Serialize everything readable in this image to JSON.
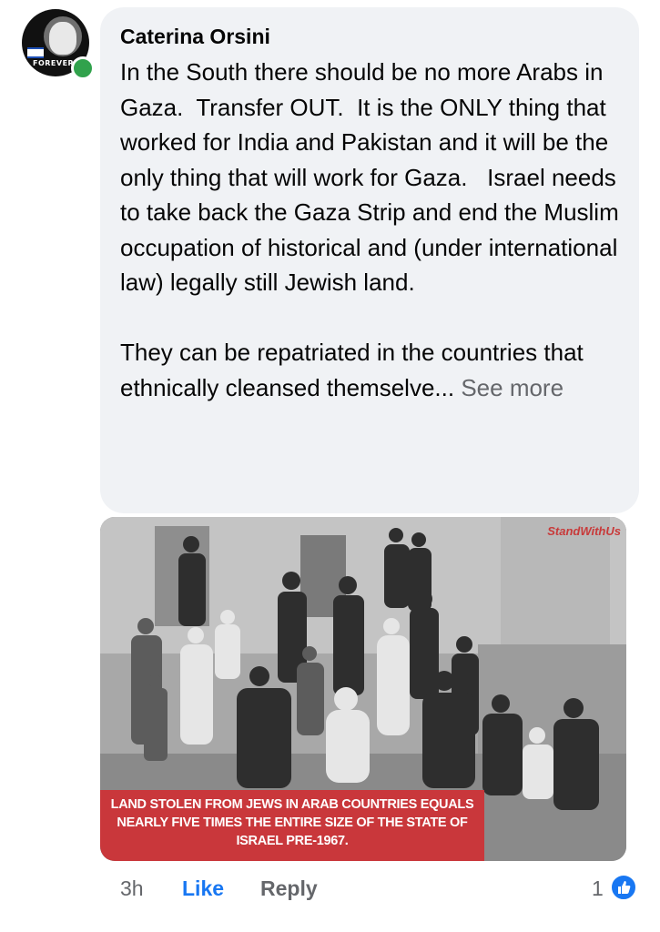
{
  "comment": {
    "avatar_caption": "FOREVER",
    "author": "Caterina Orsini",
    "paragraph_1": "In the South there should be no more Arabs in Gaza.  Transfer OUT.  It is the ONLY thing that worked for India and Pakistan and it will be the only thing that will work for Gaza.   Israel needs to take back the Gaza Strip and end the Muslim occupation of historical and (under international law) legally still Jewish land.",
    "paragraph_2": "They can be repatriated in the countries that ethnically cleansed themselve...",
    "see_more": "See more"
  },
  "image": {
    "watermark": "StandWithUs",
    "caption": "LAND STOLEN FROM JEWS IN ARAB COUNTRIES EQUALS NEARLY FIVE TIMES THE ENTIRE SIZE OF THE STATE OF ISRAEL PRE-1967."
  },
  "actions": {
    "time": "3h",
    "like_label": "Like",
    "reply_label": "Reply",
    "reaction_count": "1",
    "reaction_icon": "thumbs-up-icon"
  },
  "colors": {
    "bubble": "#f0f2f5",
    "link_blue": "#1877f2",
    "muted": "#65676b",
    "online": "#31a24c",
    "banner": "#c9373b"
  }
}
